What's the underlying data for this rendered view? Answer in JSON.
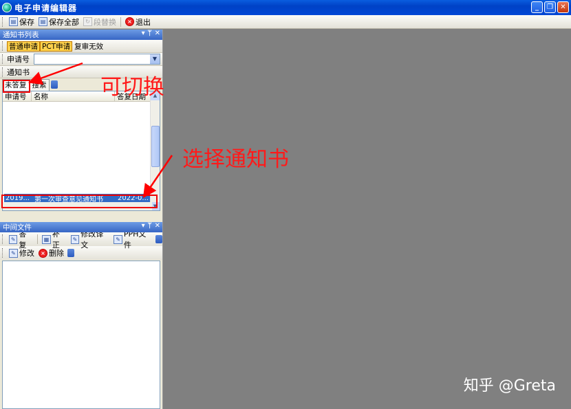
{
  "window": {
    "title": "电子申请编辑器"
  },
  "toolbar": {
    "save": "保存",
    "save_all": "保存全部",
    "replace": "段替换",
    "exit": "退出"
  },
  "pane1": {
    "title": "通知书列表",
    "filter_buttons": [
      "普通申请",
      "PCT申请",
      "复审无效"
    ],
    "apply_no_label": "申请号",
    "tab_label": "通知书",
    "tabs": [
      "未答复",
      "搜索"
    ],
    "columns": [
      "申请号",
      "名称",
      "答复日期"
    ],
    "selected_row": {
      "apply_no": "2019...",
      "name": "第一次审查意见通知书",
      "date": "2022-0..."
    }
  },
  "pane2": {
    "title": "中间文件",
    "toolbar1": [
      "答复",
      "补正",
      "修改译文",
      "PPH文件"
    ],
    "toolbar2": [
      "修改",
      "删除"
    ]
  },
  "annotations": {
    "switchable": "可切换",
    "select_notice": "选择通知书",
    "color": "#ff0000"
  },
  "watermark": "知乎 @Greta"
}
